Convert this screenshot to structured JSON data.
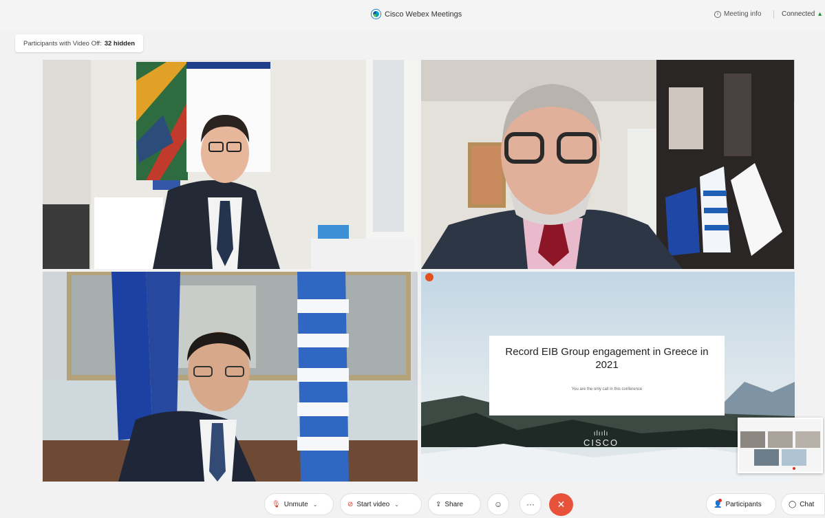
{
  "app": {
    "title": "Cisco Webex Meetings",
    "meeting_info_label": "Meeting info",
    "connection_status": "Connected"
  },
  "participants_notice": {
    "label": "Participants with Video Off:",
    "count": "32 hidden"
  },
  "shared_content": {
    "slide_title": "Record EIB Group engagement in Greece in 2021",
    "slide_subtitle": "You are the only call in this conference",
    "brand": "CISCO"
  },
  "toolbar": {
    "unmute_label": "Unmute",
    "start_video_label": "Start video",
    "share_label": "Share",
    "participants_label": "Participants",
    "chat_label": "Chat"
  },
  "icons": {
    "app": "webex-logo-icon",
    "meeting_info": "info-icon",
    "connection": "signal-icon",
    "mic": "microphone-muted-icon",
    "video": "video-off-icon",
    "share": "share-icon",
    "reactions": "emoji-icon",
    "more": "more-icon",
    "leave": "close-icon",
    "participants": "person-icon",
    "chat": "chat-bubble-icon"
  },
  "colors": {
    "leave_button": "#e8523b",
    "muted_icon": "#d93025",
    "share_badge": "#e3501e"
  }
}
